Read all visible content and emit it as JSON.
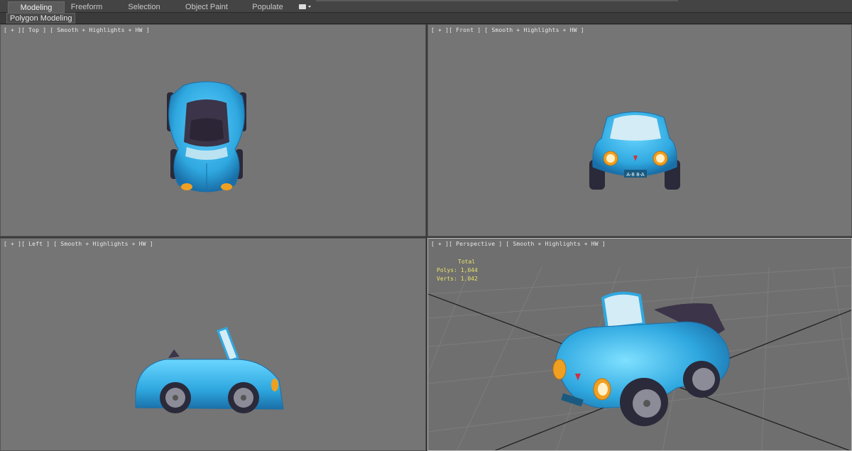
{
  "ribbon": {
    "tabs": [
      {
        "label": "Modeling",
        "active": true
      },
      {
        "label": "Freeform",
        "active": false
      },
      {
        "label": "Selection",
        "active": false
      },
      {
        "label": "Object Paint",
        "active": false
      },
      {
        "label": "Populate",
        "active": false
      }
    ],
    "panel_label": "Polygon Modeling"
  },
  "viewports": {
    "top": {
      "plus": "[ + ]",
      "view": "[ Top ]",
      "shading": "[ Smooth + Highlights + HW ]"
    },
    "front": {
      "plus": "[ + ]",
      "view": "[ Front ]",
      "shading": "[ Smooth + Highlights + HW ]"
    },
    "left": {
      "plus": "[ + ]",
      "view": "[ Left ]",
      "shading": "[ Smooth + Highlights + HW ]"
    },
    "perspective": {
      "plus": "[ + ]",
      "view": "[ Perspective ]",
      "shading": "[ Smooth + Highlights + HW ]"
    }
  },
  "stats": {
    "header": "Total",
    "polys_label": "Polys:",
    "polys_value": "1,044",
    "verts_label": "Verts:",
    "verts_value": "1,042"
  },
  "license_plate": "A-8 8-A",
  "colors": {
    "car_body": "#2fb0e6",
    "car_body_dark": "#1a7fb8",
    "headlight": "#f0a020",
    "tire": "#2a2a3a",
    "seat": "#3c3448",
    "viewport_bg": "#757575",
    "stats_text": "#e7e36a"
  }
}
